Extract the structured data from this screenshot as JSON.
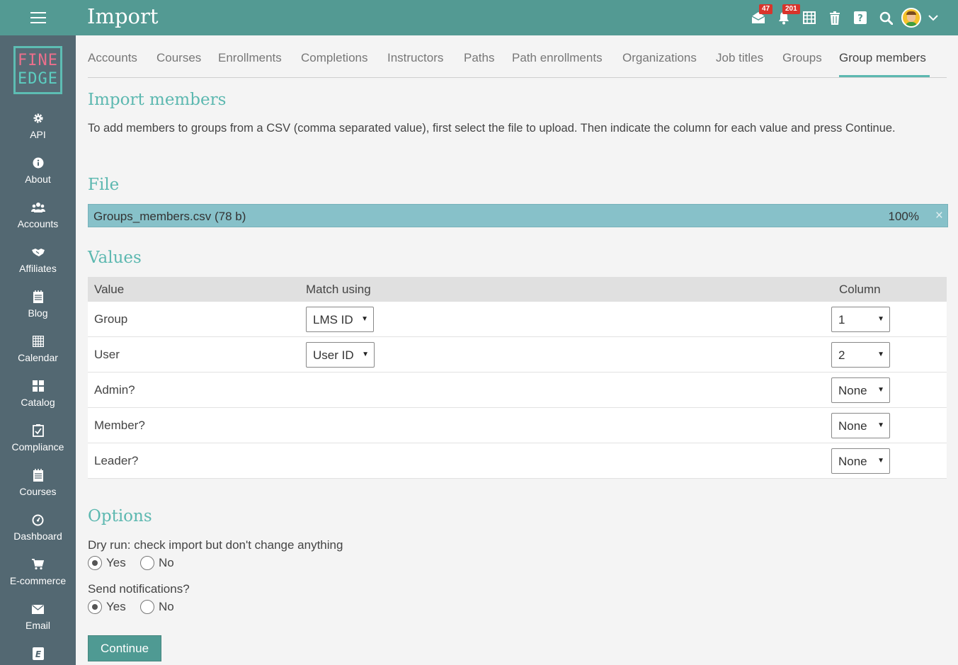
{
  "header": {
    "title": "Import",
    "icons": [
      {
        "name": "mail-icon",
        "badge": "47"
      },
      {
        "name": "bell-icon",
        "badge": "201"
      },
      {
        "name": "calendar-grid-icon"
      },
      {
        "name": "trash-icon"
      },
      {
        "name": "help-icon"
      },
      {
        "name": "search-icon"
      },
      {
        "name": "avatar"
      },
      {
        "name": "chevron-down-icon"
      }
    ],
    "mail_badge": "47",
    "bell_badge": "201"
  },
  "logo": {
    "line1": "FINE",
    "line2": "EDGE"
  },
  "sidebar": {
    "items": [
      {
        "label": "API",
        "icon": "gear-icon"
      },
      {
        "label": "About",
        "icon": "info-icon"
      },
      {
        "label": "Accounts",
        "icon": "users-icon"
      },
      {
        "label": "Affiliates",
        "icon": "handshake-icon"
      },
      {
        "label": "Blog",
        "icon": "notepad-icon"
      },
      {
        "label": "Calendar",
        "icon": "calendar-icon"
      },
      {
        "label": "Catalog",
        "icon": "grid-icon"
      },
      {
        "label": "Compliance",
        "icon": "checklist-icon"
      },
      {
        "label": "Courses",
        "icon": "notepad-icon"
      },
      {
        "label": "Dashboard",
        "icon": "gauge-icon"
      },
      {
        "label": "E-commerce",
        "icon": "cart-icon"
      },
      {
        "label": "Email",
        "icon": "envelope-icon"
      }
    ]
  },
  "tabs": [
    {
      "label": "Accounts"
    },
    {
      "label": "Courses"
    },
    {
      "label": "Enrollments"
    },
    {
      "label": "Completions"
    },
    {
      "label": "Instructors"
    },
    {
      "label": "Paths"
    },
    {
      "label": "Path enrollments"
    },
    {
      "label": "Organizations"
    },
    {
      "label": "Job titles"
    },
    {
      "label": "Groups"
    },
    {
      "label": "Group members"
    }
  ],
  "active_tab": "Group members",
  "import_section": {
    "heading": "Import members",
    "description": "To add members to groups from a CSV (comma separated value), first select the file to upload. Then indicate the column for each value and press Continue."
  },
  "file_section": {
    "heading": "File",
    "filename": "Groups_members.csv (78 b)",
    "progress": "100%",
    "close": "×"
  },
  "values_section": {
    "heading": "Values",
    "columns": [
      "Value",
      "Match using",
      "Column"
    ],
    "rows": [
      {
        "value": "Group",
        "match": "LMS ID",
        "column": "1"
      },
      {
        "value": "User",
        "match": "User ID",
        "column": "2"
      },
      {
        "value": "Admin?",
        "match": "",
        "column": "None"
      },
      {
        "value": "Member?",
        "match": "",
        "column": "None"
      },
      {
        "value": "Leader?",
        "match": "",
        "column": "None"
      }
    ]
  },
  "options_section": {
    "heading": "Options",
    "dry_run": {
      "question": "Dry run: check import but don't change anything",
      "yes": "Yes",
      "no": "No",
      "selected": "Yes"
    },
    "notifications": {
      "question": "Send notifications?",
      "yes": "Yes",
      "no": "No",
      "selected": "Yes"
    }
  },
  "continue_button": "Continue",
  "colors": {
    "topbar": "#539a93",
    "sidebar": "#536872",
    "accent": "#5cb8b0",
    "badge": "#d9342b",
    "file_bar": "#87c1c9",
    "button": "#4f9a93"
  }
}
